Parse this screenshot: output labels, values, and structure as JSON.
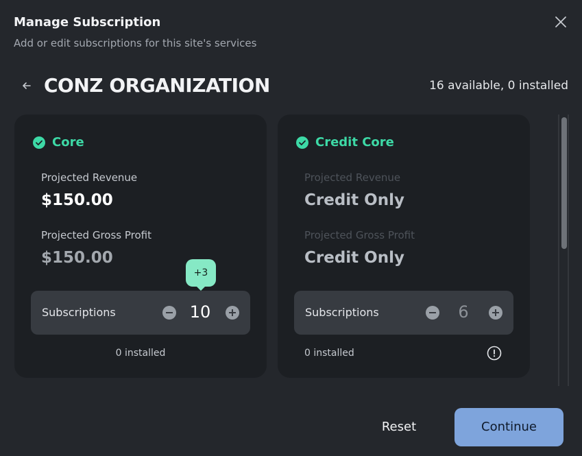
{
  "dialog": {
    "title": "Manage Subscription",
    "subtitle": "Add or edit subscriptions for this site's services"
  },
  "organization": {
    "name": "CONZ ORGANIZATION",
    "availability": "16 available, 0 installed"
  },
  "cards": [
    {
      "name": "Core",
      "revenue_label": "Projected Revenue",
      "revenue_value": "$150.00",
      "profit_label": "Projected Gross Profit",
      "profit_value": "$150.00",
      "subscriptions_label": "Subscriptions",
      "quantity": "10",
      "change_badge": "+3",
      "installed": "0 installed"
    },
    {
      "name": "Credit Core",
      "revenue_label": "Projected Revenue",
      "revenue_value": "Credit Only",
      "profit_label": "Projected Gross Profit",
      "profit_value": "Credit Only",
      "subscriptions_label": "Subscriptions",
      "quantity": "6",
      "installed": "0 installed"
    }
  ],
  "footer": {
    "reset_label": "Reset",
    "continue_label": "Continue"
  },
  "icons": {
    "close": "close-icon",
    "back": "arrow-left-icon",
    "check": "check-circle-icon",
    "minus": "minus-circle-icon",
    "plus": "plus-circle-icon",
    "info": "info-circle-icon"
  },
  "colors": {
    "background": "#24272c",
    "card": "#1c1f23",
    "accent_green": "#3dd9a6",
    "badge": "#86e9c5",
    "primary_button": "#7ea4dc"
  }
}
